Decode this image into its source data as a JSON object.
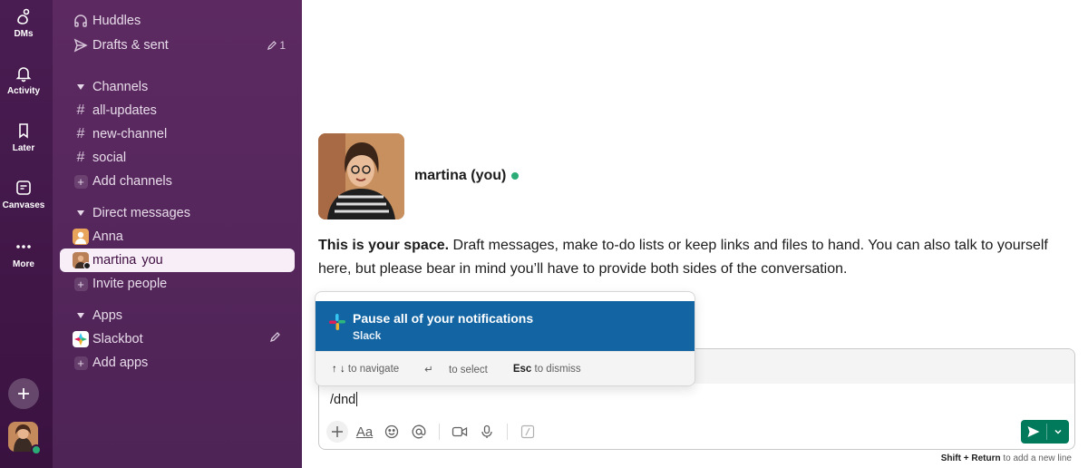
{
  "rail": {
    "items": [
      {
        "label": "DMs",
        "icon": "dms-icon"
      },
      {
        "label": "Activity",
        "icon": "bell-icon"
      },
      {
        "label": "Later",
        "icon": "bookmark-icon"
      },
      {
        "label": "Canvases",
        "icon": "canvas-icon"
      },
      {
        "label": "More",
        "icon": "more-icon"
      }
    ]
  },
  "sidebar": {
    "top_items": [
      {
        "label": "Huddles",
        "icon": "headphones-icon"
      },
      {
        "label": "Drafts & sent",
        "icon": "send-icon",
        "count": "1"
      }
    ],
    "channels_header": "Channels",
    "channels": [
      "all-updates",
      "new-channel",
      "social"
    ],
    "add_channels": "Add channels",
    "dms_header": "Direct messages",
    "dms": [
      {
        "label": "Anna",
        "you": ""
      },
      {
        "label": "martina",
        "you": "you"
      }
    ],
    "invite_people": "Invite people",
    "apps_header": "Apps",
    "apps": [
      {
        "label": "Slackbot"
      }
    ],
    "add_apps": "Add apps"
  },
  "main": {
    "profile_name": "martina (you)",
    "intro_bold": "This is your space.",
    "intro_text": "Draft messages, make to-do lists or keep links and files to hand. You can also talk to yourself here, but please bear in mind you’ll have to provide both sides of the conversation."
  },
  "popup": {
    "title": "Pause all of your notifications",
    "subtitle": "Slack",
    "hint_navigate_keys": "↑ ↓",
    "hint_navigate": "to navigate",
    "hint_select_key": "↵",
    "hint_select": "to select",
    "hint_dismiss_key": "Esc",
    "hint_dismiss": "to dismiss"
  },
  "composer": {
    "value": "/dnd",
    "hint_key": "Shift + Return",
    "hint_text": "to add a new line"
  },
  "colors": {
    "rail": "#3f0e40",
    "sidebar": "#5b2c63",
    "active_row": "#f7eef8",
    "popup_highlight": "#1264a3",
    "send": "#007a5a",
    "presence": "#2bac76"
  }
}
